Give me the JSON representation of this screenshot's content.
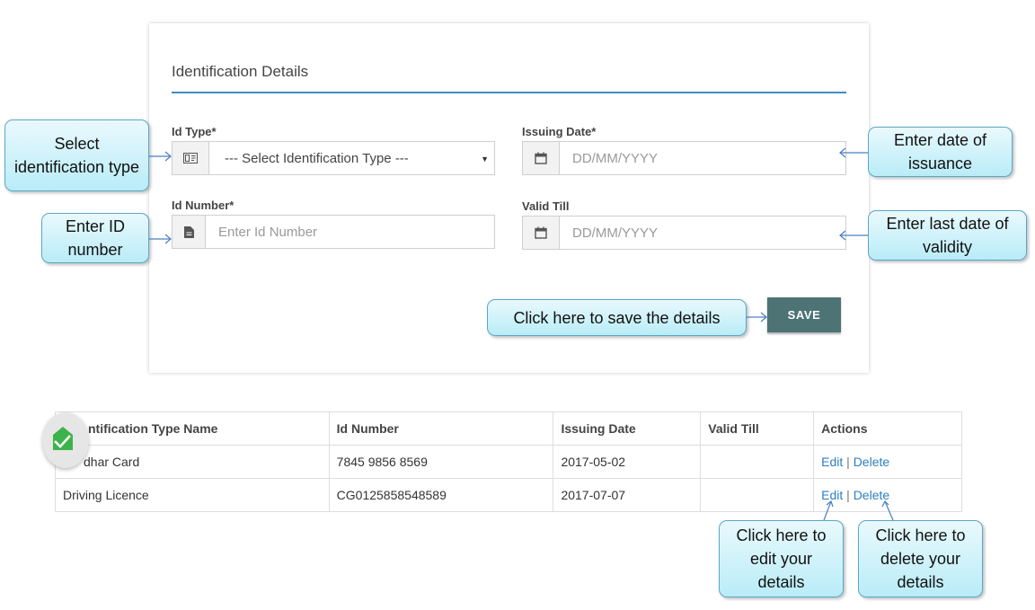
{
  "form": {
    "title": "Identification Details",
    "id_type": {
      "label": "Id Type*",
      "value": "--- Select Identification Type ---"
    },
    "issuing_date": {
      "label": "Issuing Date*",
      "placeholder": "DD/MM/YYYY"
    },
    "id_number": {
      "label": "Id Number*",
      "placeholder": "Enter Id Number"
    },
    "valid_till": {
      "label": "Valid Till",
      "placeholder": "DD/MM/YYYY"
    },
    "save_label": "SAVE"
  },
  "callouts": {
    "select_type": "Select identification type",
    "enter_id": "Enter  ID number",
    "date_issuance": "Enter date of issuance",
    "last_date": "Enter last date of validity",
    "save": "Click here to save the details",
    "edit": "Click here to edit your details",
    "delete": "Click here to delete your details"
  },
  "table": {
    "headers": [
      "ntification Type Name",
      "Id Number",
      "Issuing Date",
      "Valid Till",
      "Actions"
    ],
    "rows": [
      {
        "type": "dhar Card",
        "number": "7845 9856 8569",
        "issue": "2017-05-02",
        "valid": "",
        "edit": "Edit",
        "sep": "|",
        "delete": "Delete"
      },
      {
        "type": "Driving Licence",
        "number": "CG0125858548589",
        "issue": "2017-07-07",
        "valid": "",
        "edit": "Edit",
        "sep": "|",
        "delete": "Delete"
      }
    ]
  },
  "colors": {
    "accent": "#3b8fc0",
    "save_button": "#4d7375",
    "link": "#2c7fc0",
    "callout_fill": "#b9ecf7",
    "badge_green": "#3cb34a"
  },
  "icons": {
    "id_type": "id-card-icon",
    "date": "calendar-icon",
    "id_number": "document-icon",
    "badge": "check-icon"
  }
}
